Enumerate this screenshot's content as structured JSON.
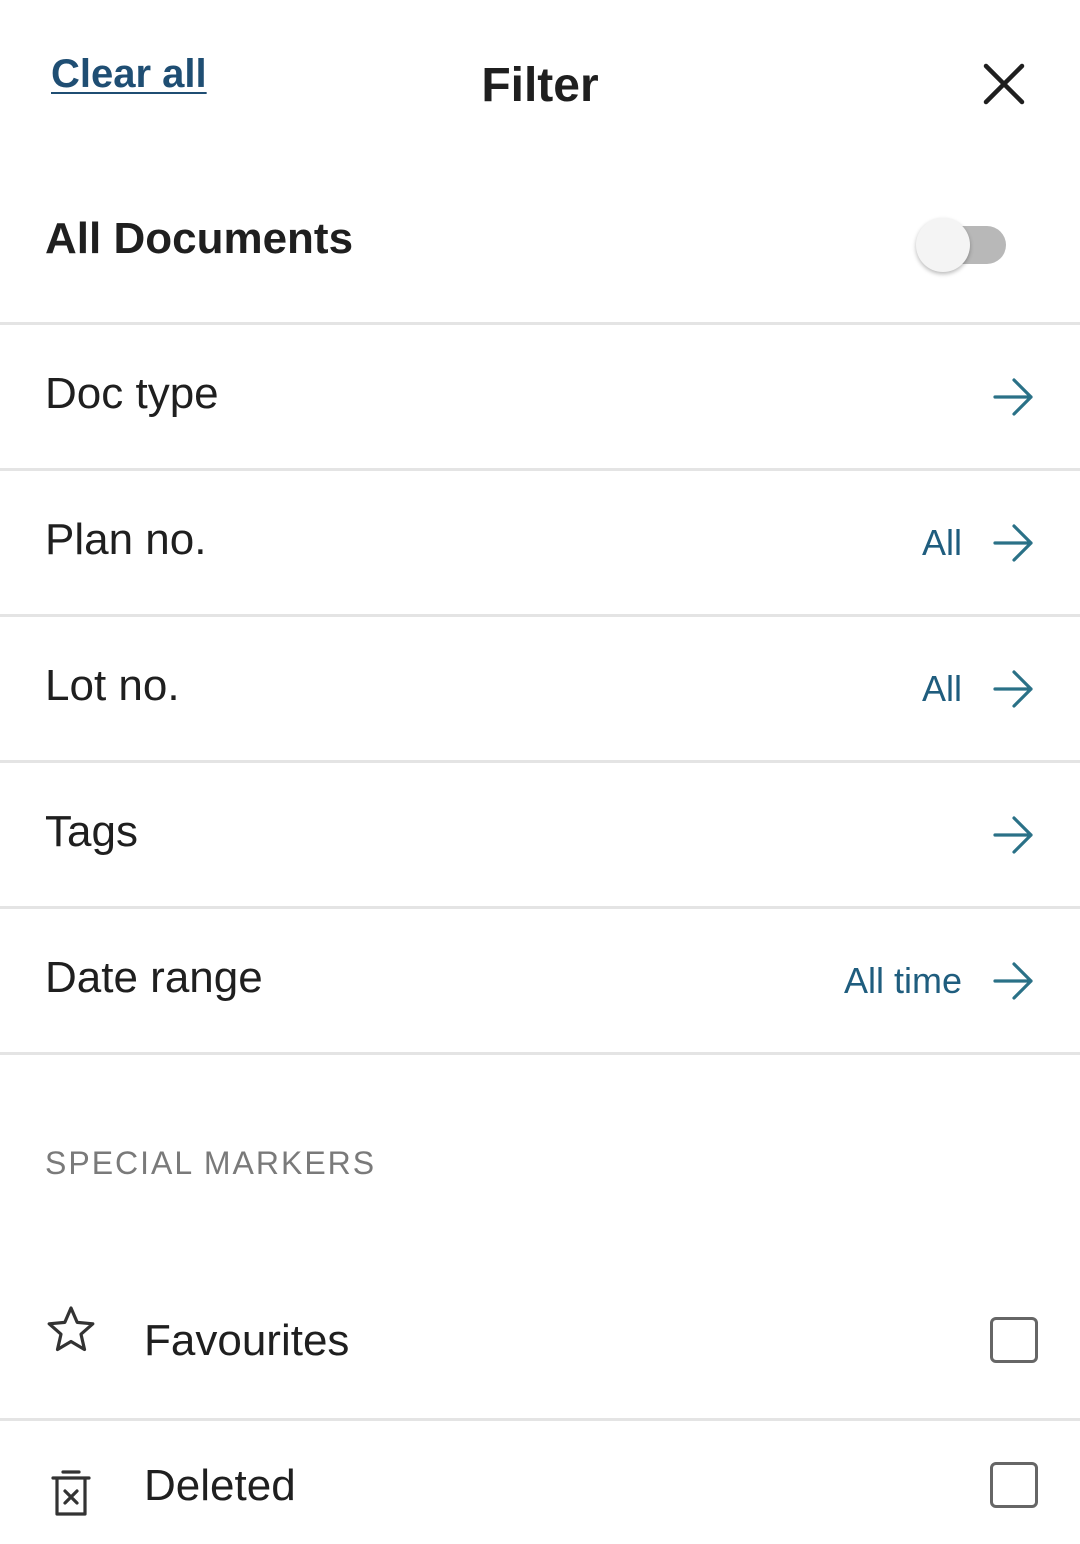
{
  "header": {
    "clear_all_label": "Clear all",
    "title": "Filter",
    "close_icon": "close-icon"
  },
  "all_documents": {
    "label": "All Documents",
    "enabled": false
  },
  "filters": [
    {
      "label": "Doc type",
      "value": ""
    },
    {
      "label": "Plan no.",
      "value": "All"
    },
    {
      "label": "Lot no.",
      "value": "All"
    },
    {
      "label": "Tags",
      "value": ""
    },
    {
      "label": "Date range",
      "value": "All time"
    }
  ],
  "special_markers": {
    "title": "SPECIAL MARKERS",
    "items": [
      {
        "label": "Favourites",
        "icon": "star-icon",
        "checked": false
      },
      {
        "label": "Deleted",
        "icon": "trash-icon",
        "checked": false
      }
    ]
  },
  "colors": {
    "link": "#1f4e73",
    "value_accent": "#1f5d7e",
    "arrow": "#2a7187",
    "divider": "#e4e4e4",
    "section_title": "#7a7a7a"
  }
}
